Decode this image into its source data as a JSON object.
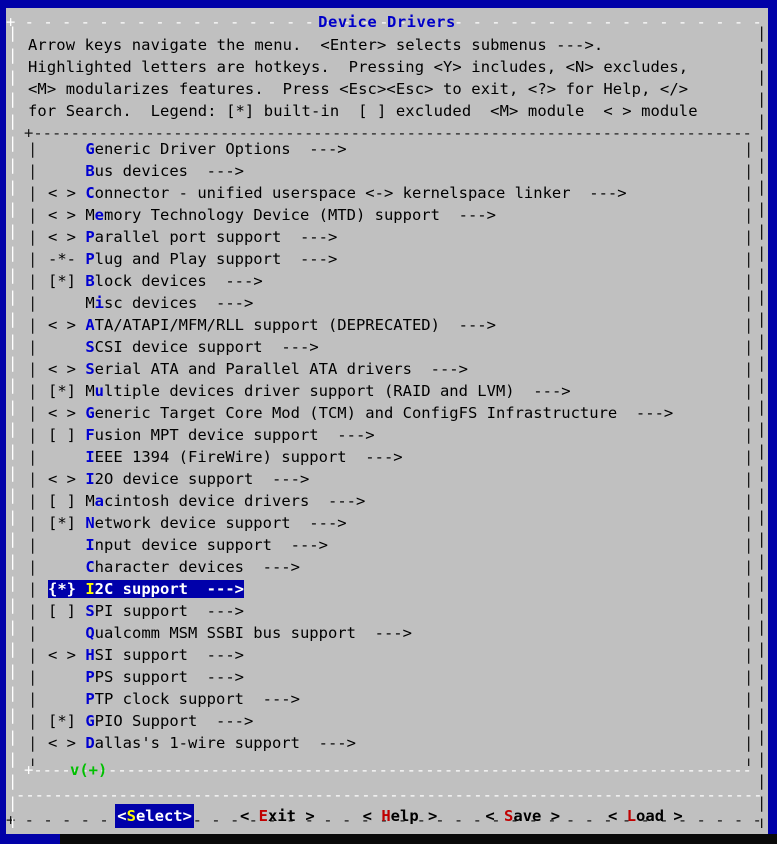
{
  "window": {
    "title": "Device Drivers",
    "title_color": "#0000c8",
    "bg_color": "#c0c0c0",
    "chrome_color": "#0000a8"
  },
  "help": {
    "lines": [
      "Arrow keys navigate the menu.  <Enter> selects submenus --->.",
      "Highlighted letters are hotkeys.  Pressing <Y> includes, <N> excludes,",
      "<M> modularizes features.  Press <Esc><Esc> to exit, <?> for Help, </>",
      "for Search.  Legend: [*] built-in  [ ] excluded  <M> module  < > module"
    ]
  },
  "menu": {
    "items": [
      {
        "prefix": "    ",
        "pre": "",
        "hotkey": "G",
        "post": "eneric Driver Options",
        "arrow": "  --->"
      },
      {
        "prefix": "    ",
        "pre": "",
        "hotkey": "B",
        "post": "us devices",
        "arrow": "  --->"
      },
      {
        "prefix": "< > ",
        "pre": "",
        "hotkey": "C",
        "post": "onnector - unified userspace <-> kernelspace linker",
        "arrow": "  --->"
      },
      {
        "prefix": "< > ",
        "pre": "M",
        "hotkey": "e",
        "post": "mory Technology Device (MTD) support",
        "arrow": "  --->"
      },
      {
        "prefix": "< > ",
        "pre": "",
        "hotkey": "P",
        "post": "arallel port support",
        "arrow": "  --->"
      },
      {
        "prefix": "-*- ",
        "pre": "",
        "hotkey": "P",
        "post": "lug and Play support",
        "arrow": "  --->"
      },
      {
        "prefix": "[*] ",
        "pre": "",
        "hotkey": "B",
        "post": "lock devices",
        "arrow": "  --->"
      },
      {
        "prefix": "    ",
        "pre": "M",
        "hotkey": "i",
        "post": "sc devices",
        "arrow": "  --->"
      },
      {
        "prefix": "< > ",
        "pre": "",
        "hotkey": "A",
        "post": "TA/ATAPI/MFM/RLL support (DEPRECATED)",
        "arrow": "  --->"
      },
      {
        "prefix": "    ",
        "pre": "",
        "hotkey": "S",
        "post": "CSI device support",
        "arrow": "  --->"
      },
      {
        "prefix": "< > ",
        "pre": "",
        "hotkey": "S",
        "post": "erial ATA and Parallel ATA drivers",
        "arrow": "  --->"
      },
      {
        "prefix": "[*] ",
        "pre": "M",
        "hotkey": "u",
        "post": "ltiple devices driver support (RAID and LVM)",
        "arrow": "  --->"
      },
      {
        "prefix": "< > ",
        "pre": "",
        "hotkey": "G",
        "post": "eneric Target Core Mod (TCM) and ConfigFS Infrastructure",
        "arrow": "  --->"
      },
      {
        "prefix": "[ ] ",
        "pre": "",
        "hotkey": "F",
        "post": "usion MPT device support",
        "arrow": "  --->"
      },
      {
        "prefix": "    ",
        "pre": "",
        "hotkey": "I",
        "post": "EEE 1394 (FireWire) support",
        "arrow": "  --->"
      },
      {
        "prefix": "< > ",
        "pre": "",
        "hotkey": "I",
        "post": "2O device support",
        "arrow": "  --->"
      },
      {
        "prefix": "[ ] ",
        "pre": "M",
        "hotkey": "a",
        "post": "cintosh device drivers",
        "arrow": "  --->"
      },
      {
        "prefix": "[*] ",
        "pre": "",
        "hotkey": "N",
        "post": "etwork device support",
        "arrow": "  --->"
      },
      {
        "prefix": "    ",
        "pre": "",
        "hotkey": "I",
        "post": "nput device support",
        "arrow": "  --->"
      },
      {
        "prefix": "    ",
        "pre": "",
        "hotkey": "C",
        "post": "haracter devices",
        "arrow": "  --->"
      },
      {
        "prefix": "{*} ",
        "pre": "",
        "hotkey": "I",
        "post": "2C support",
        "arrow": "  --->",
        "selected": true
      },
      {
        "prefix": "[ ] ",
        "pre": "",
        "hotkey": "S",
        "post": "PI support",
        "arrow": "  --->"
      },
      {
        "prefix": "    ",
        "pre": "",
        "hotkey": "Q",
        "post": "ualcomm MSM SSBI bus support",
        "arrow": "  --->"
      },
      {
        "prefix": "< > ",
        "pre": "",
        "hotkey": "H",
        "post": "SI support",
        "arrow": "  --->"
      },
      {
        "prefix": "    ",
        "pre": "",
        "hotkey": "P",
        "post": "PS support",
        "arrow": "  --->"
      },
      {
        "prefix": "    ",
        "pre": "",
        "hotkey": "P",
        "post": "TP clock support",
        "arrow": "  --->"
      },
      {
        "prefix": "[*] ",
        "pre": "",
        "hotkey": "G",
        "post": "PIO Support",
        "arrow": "  --->"
      },
      {
        "prefix": "< > ",
        "pre": "",
        "hotkey": "D",
        "post": "allas's 1-wire support",
        "arrow": "  --->"
      }
    ],
    "scroll_down_indicator": "v(+)",
    "scroll_indicator_color": "#00c000"
  },
  "buttons": [
    {
      "open": "<",
      "pre": "",
      "hotkey": "S",
      "post": "elect",
      "close": ">",
      "active": true
    },
    {
      "open": "< ",
      "pre": "",
      "hotkey": "E",
      "post": "xit",
      "close": " >",
      "active": false
    },
    {
      "open": "< ",
      "pre": "",
      "hotkey": "H",
      "post": "elp",
      "close": " >",
      "active": false
    },
    {
      "open": "< ",
      "pre": "",
      "hotkey": "S",
      "post": "ave",
      "close": " >",
      "active": false
    },
    {
      "open": "< ",
      "pre": "",
      "hotkey": "L",
      "post": "oad",
      "close": " >",
      "active": false
    }
  ]
}
